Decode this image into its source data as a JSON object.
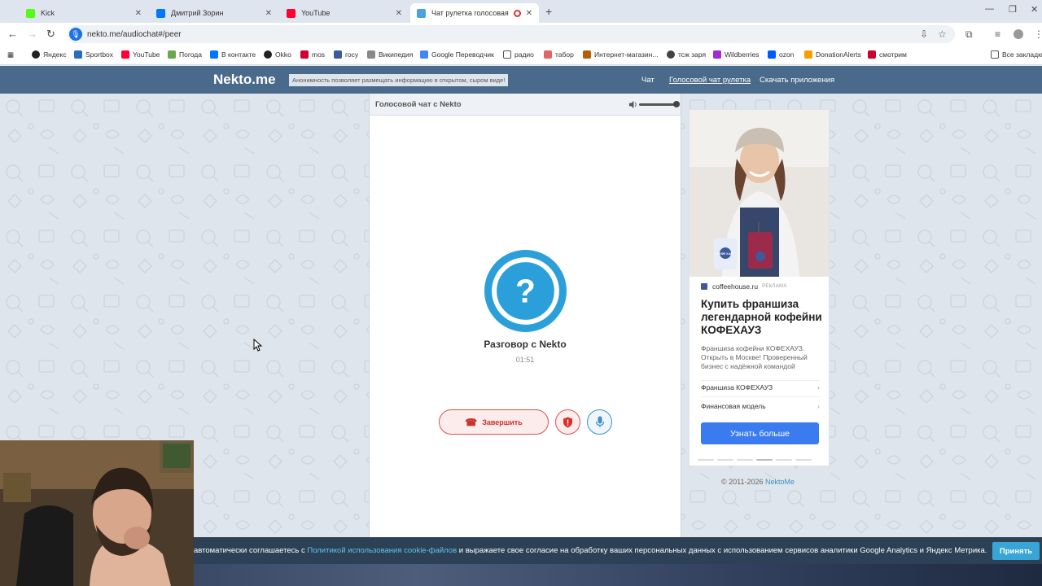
{
  "browser": {
    "tabs": [
      {
        "title": "Kick",
        "favicon_color": "#53fc18"
      },
      {
        "title": "Дмитрий Зорин",
        "favicon_color": "#0077ff"
      },
      {
        "title": "YouTube",
        "favicon_color": "#ff0033"
      },
      {
        "title": "Чат рулетка голосовая —",
        "favicon_color": "#4aa3df"
      }
    ],
    "url": "nekto.me/audiochat#/peer",
    "bookmarks": [
      {
        "label": "Яндекс",
        "color": "#222"
      },
      {
        "label": "Sportbox",
        "color": "#2a6ebb"
      },
      {
        "label": "YouTube",
        "color": "#ff0033"
      },
      {
        "label": "Погода",
        "color": "#6aa84f"
      },
      {
        "label": "В контакте",
        "color": "#0077ff"
      },
      {
        "label": "Okko",
        "color": "#222"
      },
      {
        "label": "mos",
        "color": "#cc0033"
      },
      {
        "label": "госу",
        "color": "#3b5b9c"
      },
      {
        "label": "Википедия",
        "color": "#666"
      },
      {
        "label": "Google Переводчик",
        "color": "#4285f4"
      },
      {
        "label": "радио",
        "color": "#555"
      },
      {
        "label": "табор",
        "color": "#e06666"
      },
      {
        "label": "Интернет-магазин...",
        "color": "#b45f06"
      },
      {
        "label": "тсж заря",
        "color": "#444"
      },
      {
        "label": "Wildberries",
        "color": "#a12bd6"
      },
      {
        "label": "ozon",
        "color": "#005bff"
      },
      {
        "label": "DonationAlerts",
        "color": "#f6a000"
      },
      {
        "label": "смотрим",
        "color": "#cc0033"
      },
      {
        "label": "Все закладки",
        "color": "#555"
      }
    ]
  },
  "site": {
    "logo": "Nekto.me",
    "notice": "Анонимность позволяет размещать информацию в открытом, сыром виде!",
    "nav": [
      "Чат",
      "Голосовой чат рулетка",
      "Скачать приложения"
    ]
  },
  "chat": {
    "header_title": "Голосовой чат с Nekto",
    "avatar_symbol": "?",
    "peer_name": "Разговор с Nekto",
    "timer": "01:51",
    "end_button": "Завершить"
  },
  "ad": {
    "domain": "coffeehouse.ru",
    "label": "РЕКЛАМА",
    "title": "Купить франшиза легендарной кофейни КОФЕХАУЗ",
    "description": "Франшиза кофейни КОФЕХАУЗ. Открыть в Москве! Проверенный бизнес с надёжной командой",
    "links": [
      "Франшиза КОФЕХАУЗ",
      "Финансовая модель"
    ],
    "cta": "Узнать больше",
    "cup_label": "КОФЕ ХАУЗ",
    "brand_color": "#3b7bf0"
  },
  "footer": {
    "copyright": "© 2011-2026",
    "copyright_link": "NektoMe"
  },
  "cookie": {
    "text_before": "автоматически соглашаетесь с ",
    "link": "Политикой использования cookie-файлов",
    "text_after": " и выражаете свое согласие на обработку ваших персональных данных с использованием сервисов аналитики Google Analytics и Яндекс Метрика.",
    "accept": "Принять"
  }
}
